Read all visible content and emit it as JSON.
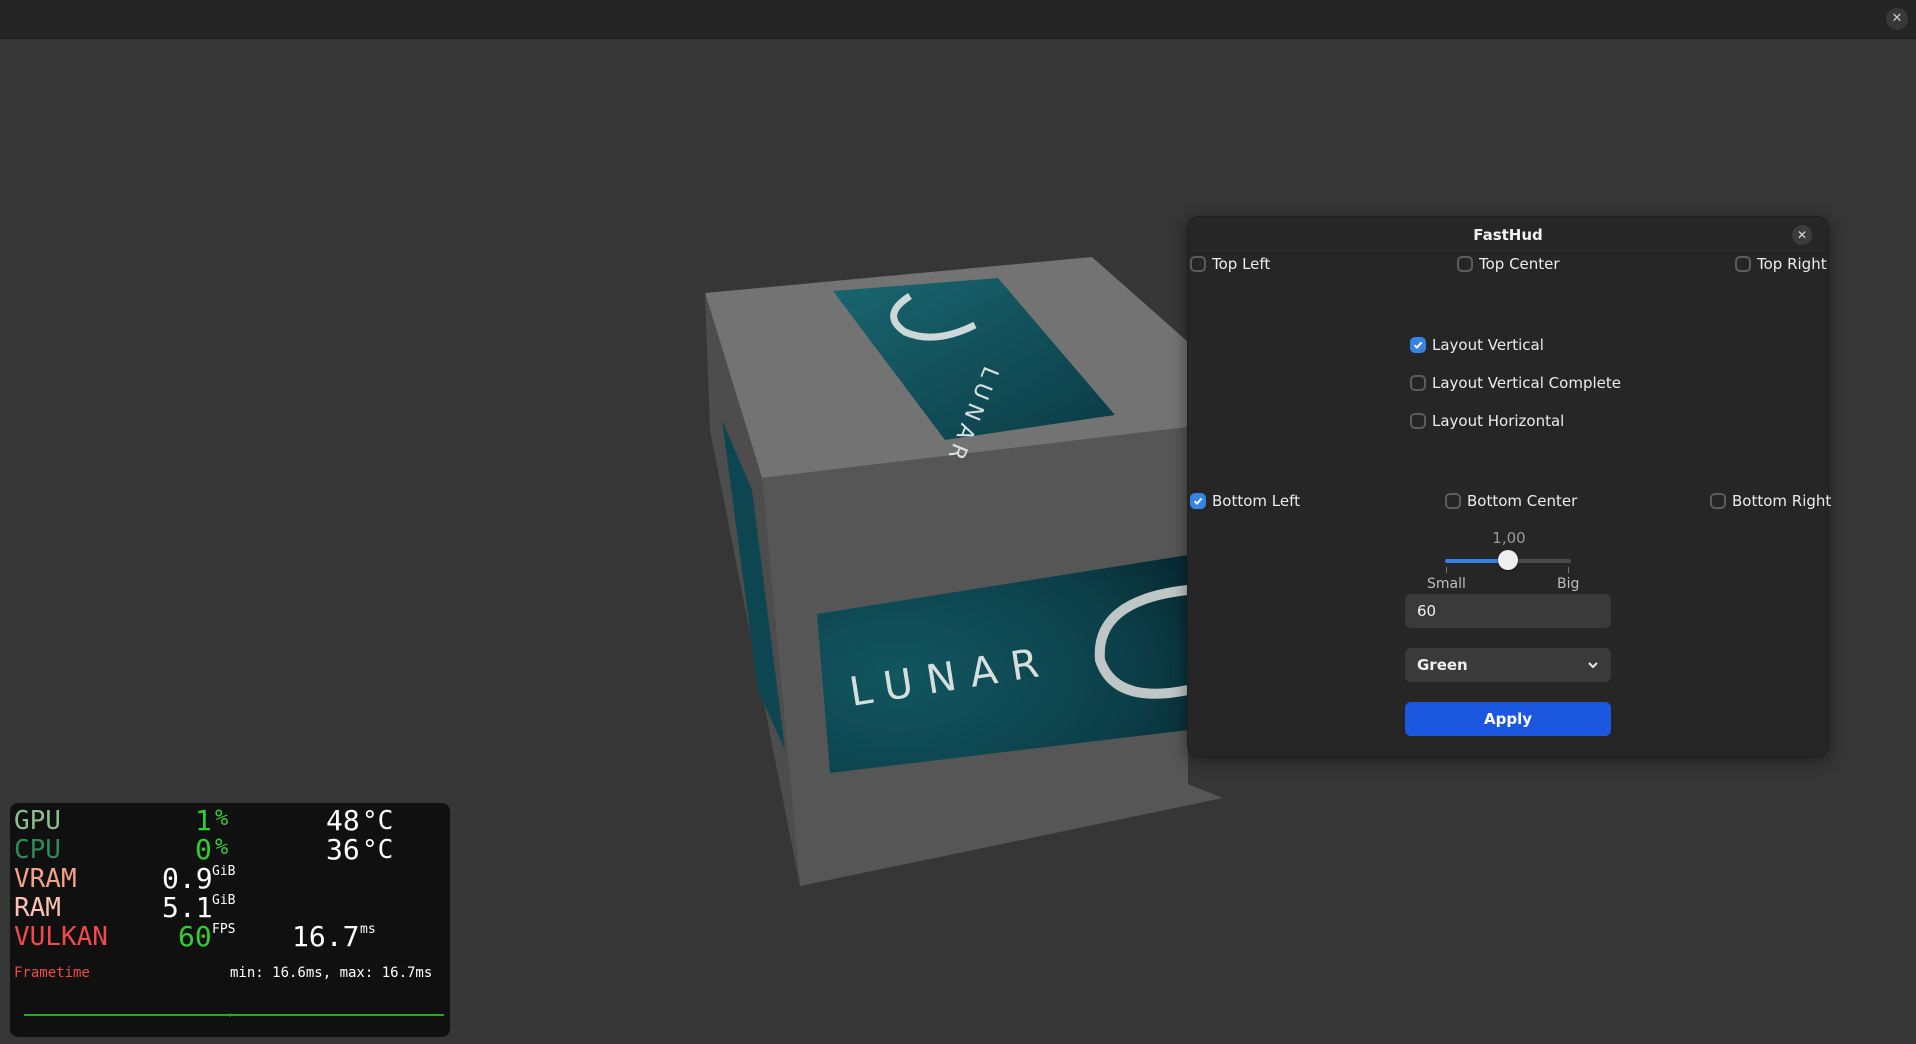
{
  "window": {
    "close_glyph": "✕"
  },
  "scene": {
    "cube_front_text": "LUNAR",
    "cube_top_text": "LUNAR"
  },
  "dialog": {
    "title": "FastHud",
    "close_glyph": "✕",
    "positions": {
      "top_left": {
        "label": "Top Left",
        "checked": false
      },
      "top_center": {
        "label": "Top Center",
        "checked": false
      },
      "top_right": {
        "label": "Top Right",
        "checked": false
      },
      "bottom_left": {
        "label": "Bottom Left",
        "checked": true
      },
      "bottom_center": {
        "label": "Bottom Center",
        "checked": false
      },
      "bottom_right": {
        "label": "Bottom Right",
        "checked": false
      }
    },
    "layouts": {
      "vertical": {
        "label": "Layout Vertical",
        "checked": true
      },
      "vertical_complete": {
        "label": "Layout Vertical Complete",
        "checked": false
      },
      "horizontal": {
        "label": "Layout Horizontal",
        "checked": false
      }
    },
    "scale": {
      "value_text": "1,00",
      "fraction": 0.5,
      "min_label": "Small",
      "max_label": "Big"
    },
    "fps_input": {
      "value": "60"
    },
    "color_select": {
      "value": "Green"
    },
    "apply_label": "Apply"
  },
  "hud": {
    "colors": {
      "gpu": "#8fbc8f",
      "cpu": "#2e8b57",
      "vram": "#f2a48a",
      "ram": "#ffc1b2",
      "vulkan": "#f04a4a",
      "value_green": "#32cd32",
      "frametime_line": "#22aa22"
    },
    "gpu": {
      "label": "GPU",
      "load": "1",
      "load_unit": "%",
      "temp": "48",
      "temp_unit": "°C"
    },
    "cpu": {
      "label": "CPU",
      "load": "0",
      "load_unit": "%",
      "temp": "36",
      "temp_unit": "°C"
    },
    "vram": {
      "label": "VRAM",
      "value": "0.9",
      "unit": "GiB"
    },
    "ram": {
      "label": "RAM",
      "value": "5.1",
      "unit": "GiB"
    },
    "vulkan": {
      "label": "VULKAN",
      "fps": "60",
      "fps_unit": "FPS",
      "frametime": "16.7",
      "frametime_unit": "ms"
    },
    "frametime": {
      "label": "Frametime",
      "stats": "min: 16.6ms, max: 16.7ms"
    }
  }
}
